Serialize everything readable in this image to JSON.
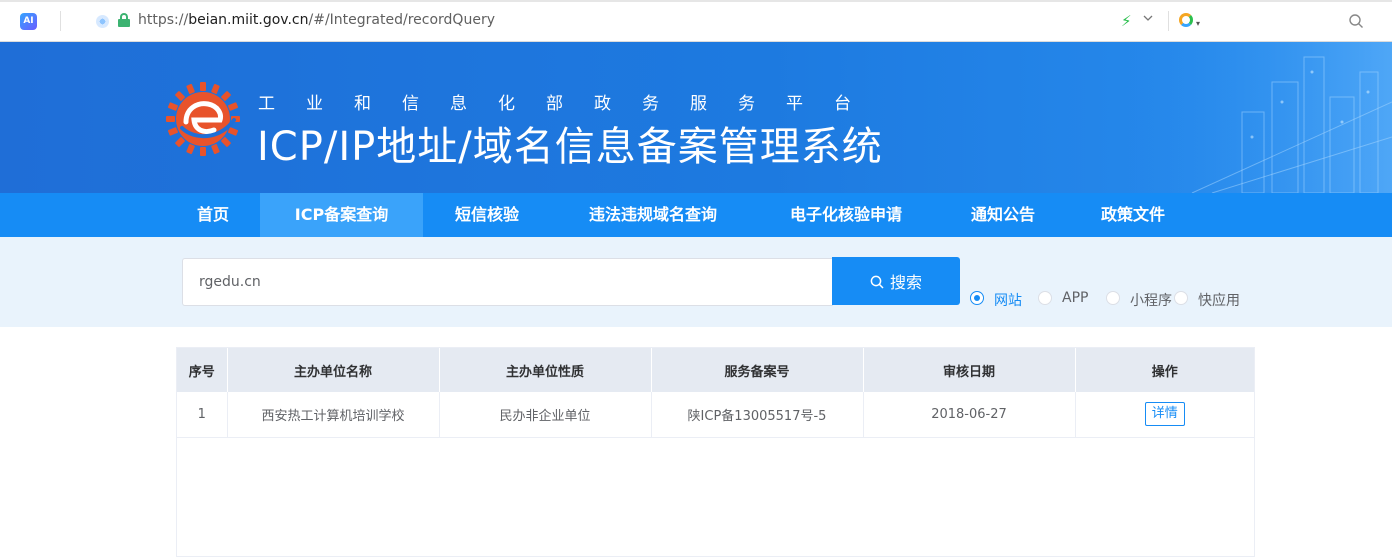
{
  "browser": {
    "ai_label": "AI",
    "url_scheme": "https://",
    "url_host": "beian.miit.gov.cn",
    "url_path": "/#/Integrated/recordQuery"
  },
  "header": {
    "subtitle": "工业和信息化部政务服务平台",
    "title": "ICP/IP地址/域名信息备案管理系统"
  },
  "nav": {
    "items": [
      {
        "label": "首页"
      },
      {
        "label": "ICP备案查询"
      },
      {
        "label": "短信核验"
      },
      {
        "label": "违法违规域名查询"
      },
      {
        "label": "电子化核验申请"
      },
      {
        "label": "通知公告"
      },
      {
        "label": "政策文件"
      }
    ],
    "active": "ICP备案查询"
  },
  "search": {
    "value": "rgedu.cn",
    "button_label": "搜索",
    "options": [
      {
        "label": "网站",
        "checked": true
      },
      {
        "label": "APP",
        "checked": false
      },
      {
        "label": "小程序",
        "checked": false
      },
      {
        "label": "快应用",
        "checked": false
      }
    ]
  },
  "table": {
    "headers": [
      "序号",
      "主办单位名称",
      "主办单位性质",
      "服务备案号",
      "审核日期",
      "操作"
    ],
    "rows": [
      {
        "index": "1",
        "name": "西安热工计算机培训学校",
        "nature": "民办非企业单位",
        "license": "陕ICP备13005517号-5",
        "date": "2018-06-27",
        "action": "详情"
      }
    ]
  },
  "colors": {
    "brand": "#168cf5",
    "nav_active": "#3aa3fa",
    "banner": "#1f6ed7",
    "search_bg": "#e9f3fc"
  }
}
